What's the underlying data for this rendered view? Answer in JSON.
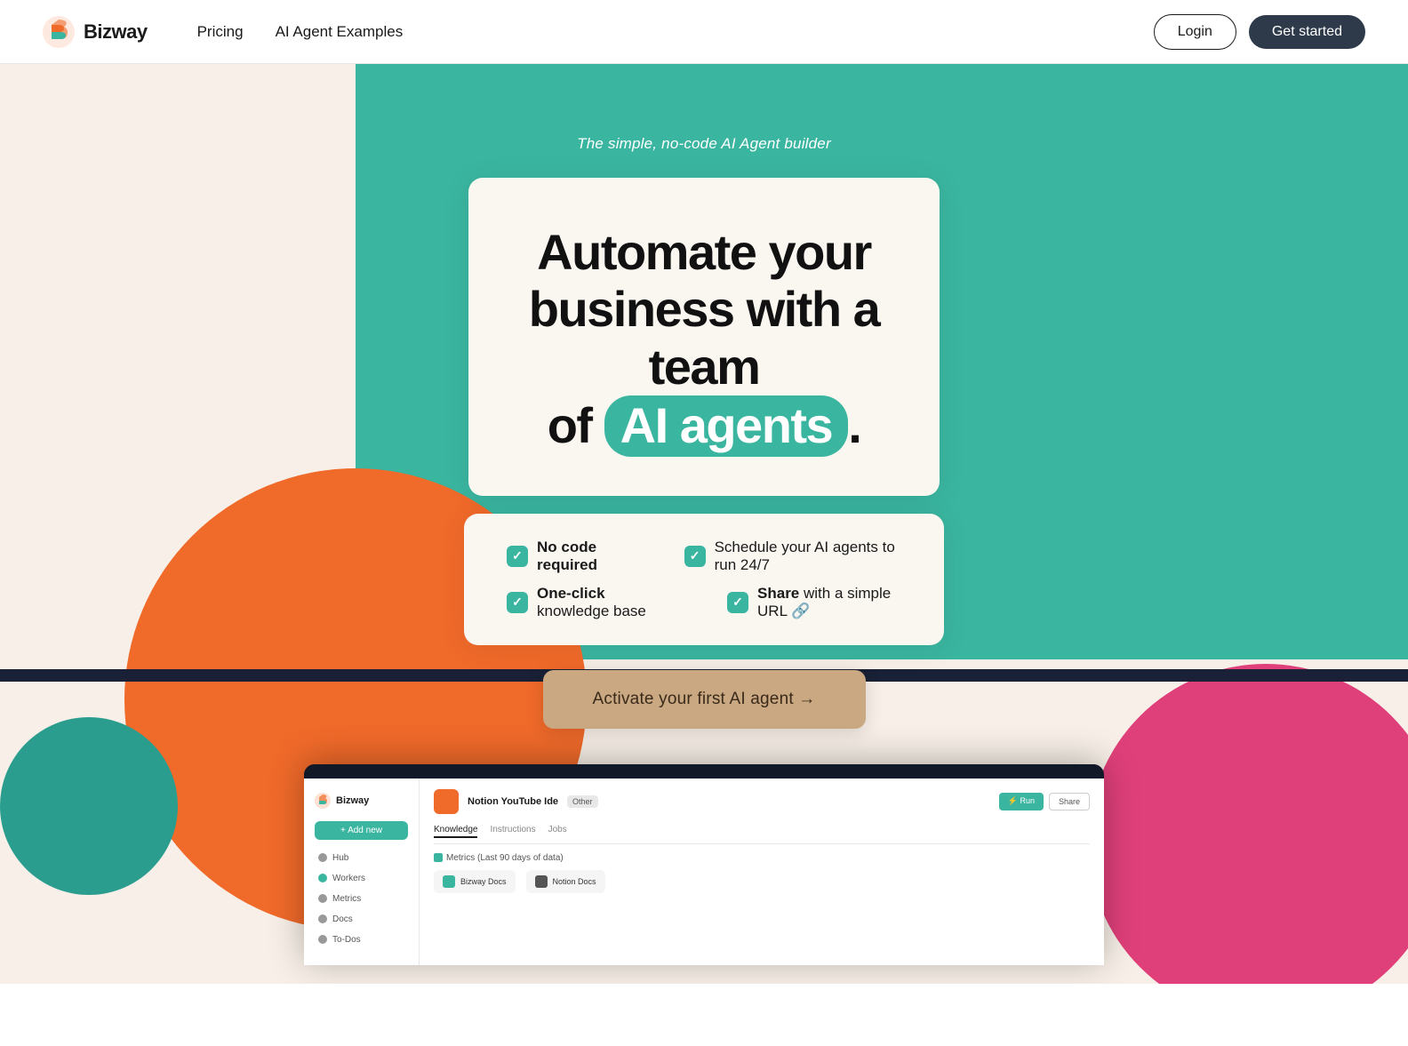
{
  "nav": {
    "logo_text": "Bizway",
    "links": [
      {
        "label": "Pricing",
        "id": "pricing"
      },
      {
        "label": "AI Agent Examples",
        "id": "ai-agent-examples"
      }
    ],
    "login_label": "Login",
    "get_started_label": "Get started"
  },
  "hero": {
    "subtitle": "The simple, no-code AI Agent builder",
    "headline_line1": "Automate your",
    "headline_line2": "business with a team",
    "headline_line3_prefix": "of",
    "headline_highlight": "AI agents",
    "headline_suffix": ".",
    "features": [
      {
        "label": "No code required",
        "bold": "No code required"
      },
      {
        "label": "Schedule your AI agents to run 24/7",
        "bold": "Schedule"
      },
      {
        "label": "One-click knowledge base",
        "bold": "One-click"
      },
      {
        "label": "Share with a simple URL 🔗",
        "bold": "Share"
      }
    ],
    "cta_label": "Activate your first AI agent →"
  },
  "mockup": {
    "logo": "Bizway",
    "add_new": "+ Add new",
    "nav_items": [
      "Hub",
      "Workers",
      "Metrics",
      "Docs",
      "To-Dos"
    ],
    "agent_name": "Notion YouTube Ide",
    "tag": "Other",
    "run_label": "Run",
    "share_label": "Share",
    "tabs": [
      "Knowledge",
      "Instructions",
      "Jobs"
    ],
    "active_tab": "Knowledge",
    "section_label": "Metrics  (Last 90 days of data)",
    "docs": [
      {
        "name": "Bizway Docs",
        "color": "#3ab5a0"
      },
      {
        "name": "Notion Docs",
        "color": "#555"
      }
    ]
  },
  "colors": {
    "teal": "#3ab5a0",
    "orange": "#f06a2a",
    "pink": "#e0407a",
    "dark": "#2e3a4a",
    "cream": "#faf6f0",
    "cta_bg": "#c9a882"
  }
}
